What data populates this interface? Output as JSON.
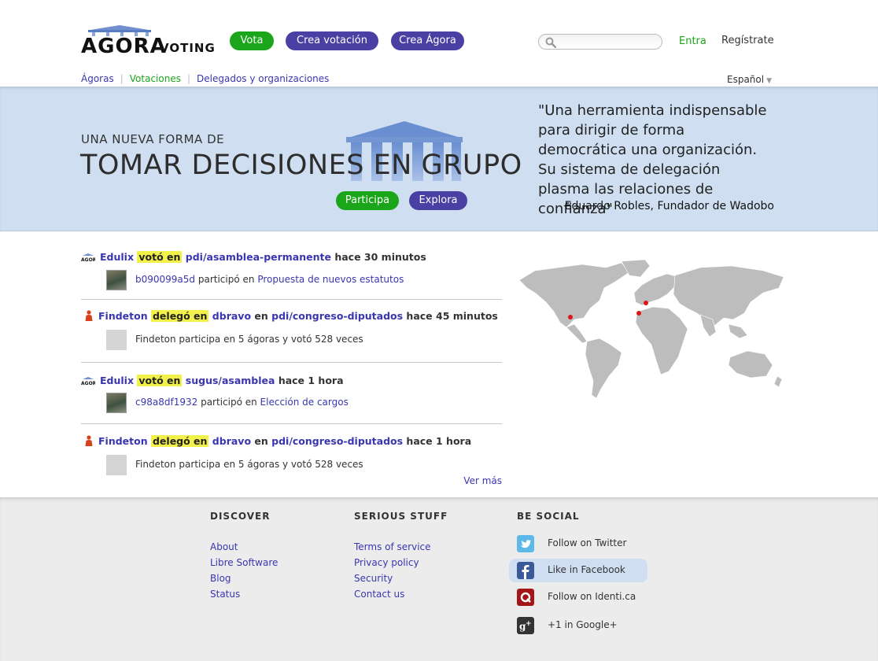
{
  "header": {
    "logo_main": "AGORA",
    "logo_sub": "VOTING",
    "buttons": {
      "vote": "Vota",
      "create_vote": "Crea votación",
      "create_agora": "Crea Ágora"
    },
    "search_placeholder": "",
    "login": "Entra",
    "register": "Regístrate"
  },
  "subnav": {
    "agoras": "Ágoras",
    "votes": "Votaciones",
    "delegates": "Delegados y organizaciones"
  },
  "language": {
    "selected": "Español"
  },
  "hero": {
    "kicker": "UNA NUEVA FORMA DE",
    "title": "TOMAR DECISIONES EN GRUPO",
    "participate": "Participa",
    "explore": "Explora",
    "quote": "\"Una herramienta indispensable para dirigir de forma democrática una organización. Su sistema de delegación plasma las relaciones de confianza\"",
    "quote_author": "Eduardo Robles, Fundador de Wadobo"
  },
  "activity": {
    "items": [
      {
        "actor": "Edulix",
        "verb": "votó en",
        "target": "pdi/asamblea-permanente",
        "time": "hace 30 minutos",
        "sub_user": "b090099a5d",
        "sub_text": "participó en",
        "sub_link": "Propuesta de nuevos estatutos"
      },
      {
        "actor": "Findeton",
        "verb": "delegó en",
        "target": "dbravo",
        "connector": "en",
        "target2": "pdi/congreso-diputados",
        "time": "hace 45 minutos",
        "sub_text": "Findeton participa en 5 ágoras y votó 528 veces"
      },
      {
        "actor": "Edulix",
        "verb": "votó en",
        "target": "sugus/asamblea",
        "time": "hace 1 hora",
        "sub_user": "c98a8df1932",
        "sub_text": "participó en",
        "sub_link": "Elección de cargos"
      },
      {
        "actor": "Findeton",
        "verb": "delegó en",
        "target": "dbravo",
        "connector": "en",
        "target2": "pdi/congreso-diputados",
        "time": "hace 1 hora",
        "sub_text": "Findeton participa en 5 ágoras y votó 528 veces"
      }
    ],
    "more": "Ver más"
  },
  "footer": {
    "discover": {
      "title": "DISCOVER",
      "links": [
        "About",
        "Libre Software",
        "Blog",
        "Status"
      ]
    },
    "serious": {
      "title": "SERIOUS STUFF",
      "links": [
        "Terms of service",
        "Privacy policy",
        "Security",
        "Contact us"
      ]
    },
    "social": {
      "title": "BE SOCIAL",
      "items": [
        {
          "label": "Follow on Twitter",
          "icon": "twitter-icon"
        },
        {
          "label": "Like in Facebook",
          "icon": "facebook-icon"
        },
        {
          "label": "Follow on Identi.ca",
          "icon": "identica-icon"
        },
        {
          "label": "+1 in Google+",
          "icon": "google-plus-icon"
        }
      ]
    }
  },
  "colors": {
    "green": "#1aa51a",
    "purple": "#4a3fa3",
    "link": "#3a36b0",
    "hero_bg": "#cfdff1",
    "highlight": "#f2f04a"
  }
}
